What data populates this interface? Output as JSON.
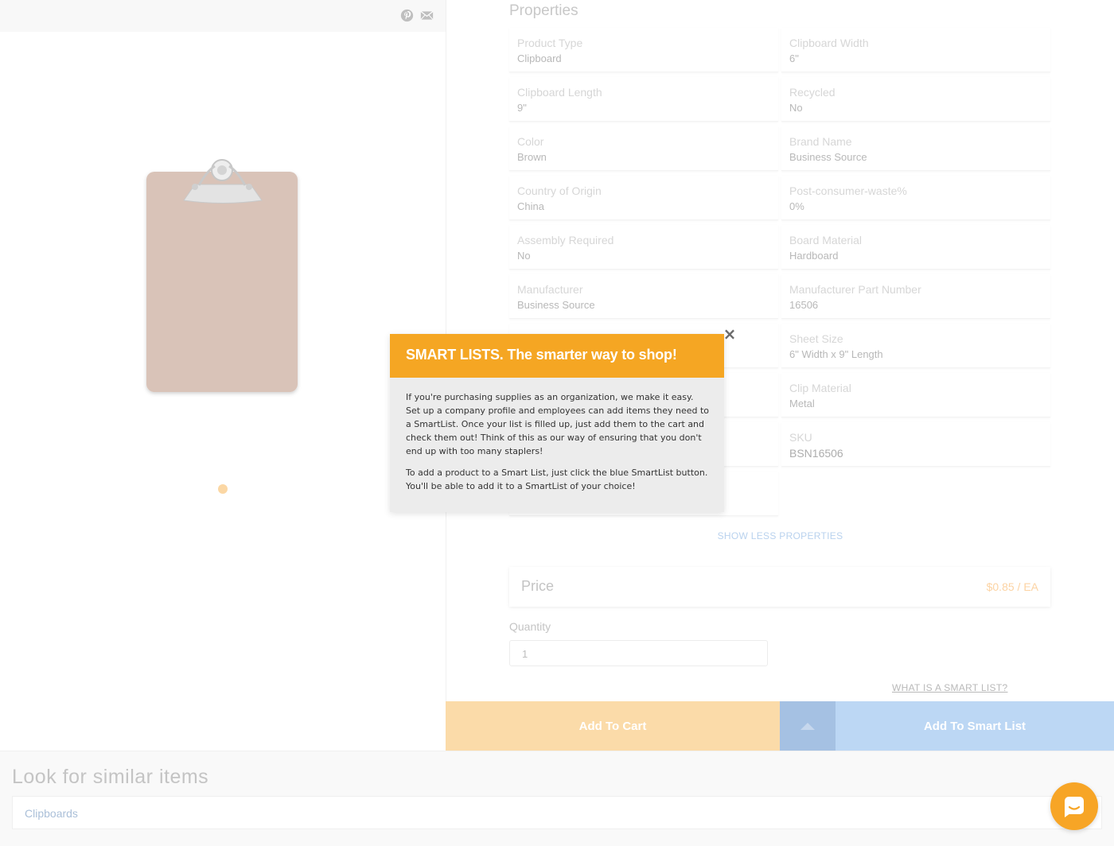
{
  "share": {
    "pinterest_icon": "pinterest-icon",
    "email_icon": "email-icon"
  },
  "product": {
    "image_icon": "clipboard-image",
    "carousel_dots": 1
  },
  "properties": {
    "title": "Properties",
    "items": [
      {
        "label": "Product Type",
        "value": "Clipboard"
      },
      {
        "label": "Clipboard Width",
        "value": "6\""
      },
      {
        "label": "Clipboard Length",
        "value": "9\""
      },
      {
        "label": "Recycled",
        "value": "No"
      },
      {
        "label": "Color",
        "value": "Brown"
      },
      {
        "label": "Brand Name",
        "value": "Business Source"
      },
      {
        "label": "Country of Origin",
        "value": "China"
      },
      {
        "label": "Post-consumer-waste%",
        "value": "0%"
      },
      {
        "label": "Assembly Required",
        "value": "No"
      },
      {
        "label": "Board Material",
        "value": "Hardboard"
      },
      {
        "label": "Manufacturer",
        "value": "Business Source"
      },
      {
        "label": "Manufacturer Part Number",
        "value": "16506"
      },
      {
        "label": "Sheet Size",
        "value": "6\" Width x 9\" Length"
      },
      {
        "label": "Clip Material",
        "value": "Metal"
      },
      {
        "label": "SKU",
        "value": "BSN16506"
      }
    ],
    "show_less": "SHOW LESS PROPERTIES"
  },
  "price": {
    "label": "Price",
    "value": "$0.85 / EA"
  },
  "quantity": {
    "label": "Quantity",
    "value": "1"
  },
  "smart_list_link": "WHAT IS A SMART LIST?",
  "actions": {
    "add_to_cart": "Add To Cart",
    "add_to_smart_list": "Add To Smart List"
  },
  "similar": {
    "title": "Look for similar items",
    "value": "Clipboards"
  },
  "modal": {
    "title": "SMART LISTS. The smarter way to shop!",
    "close": "×",
    "paragraphs": [
      "If you're purchasing supplies as an organization, we make it easy. Set up a company profile and employees can add items they need to a SmartList. Once your list is filled up, just add them to the cart and check them out! Think of this as our way of ensuring that you don't end up with too many staplers!",
      "To add a product to a Smart List, just click the blue SmartList button. You'll be able to add it to a SmartList of your choice!"
    ]
  },
  "colors": {
    "accent": "#f5a623",
    "blue": "#bcd7f4",
    "cart": "#fbdba9"
  }
}
